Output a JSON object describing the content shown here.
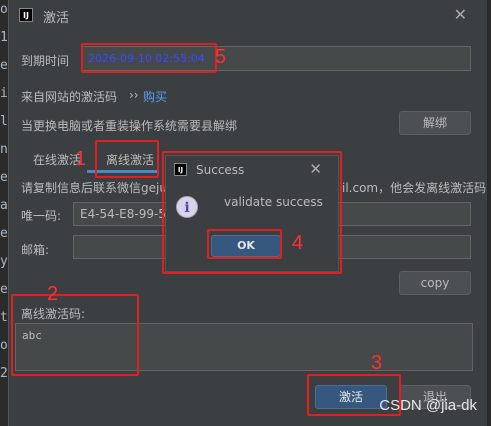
{
  "background_code_glyphs": [
    "o",
    "1",
    "e",
    "i",
    "l",
    "n",
    "e",
    "a",
    "e",
    "y",
    "e",
    "t",
    "o",
    "2"
  ],
  "window": {
    "title": "激活",
    "app_icon_text": "IJ",
    "close_glyph": "✕"
  },
  "expiry": {
    "label": "到期时间",
    "value": "2026-09-10 02:55:04"
  },
  "website": {
    "label": "来自网站的激活码",
    "separator": "››",
    "buy_link": "购买"
  },
  "unbind": {
    "label": "当更换电脑或者重装操作系统需要县解绑",
    "button": "解绑"
  },
  "tabs": [
    {
      "label": "在线激活"
    },
    {
      "label": "离线激活"
    }
  ],
  "offline": {
    "instruction_left": "请复制信息后联系微信geju",
    "instruction_right": "il.com，他会发离线激活码",
    "unique_code_label": "唯一码:",
    "unique_code_value": "E4-54-E8-99-5",
    "email_label": "邮箱:",
    "copy_button": "copy",
    "offline_code_label": "离线激活码:",
    "offline_code_value": "abc"
  },
  "footer": {
    "activate_button": "激活",
    "exit_button": "退出"
  },
  "popup": {
    "title": "Success",
    "close_glyph": "✕",
    "info_icon_text": "i",
    "message": "validate success",
    "ok_button": "OK"
  },
  "annotations": [
    "1",
    "2",
    "3",
    "4",
    "5"
  ],
  "watermark": "CSDN @jia-dk",
  "colors": {
    "accent_blue": "#4a88c7",
    "expiry_value": "#3b48ff",
    "annotation_red": "#e02020",
    "primary_button": "#365880"
  }
}
